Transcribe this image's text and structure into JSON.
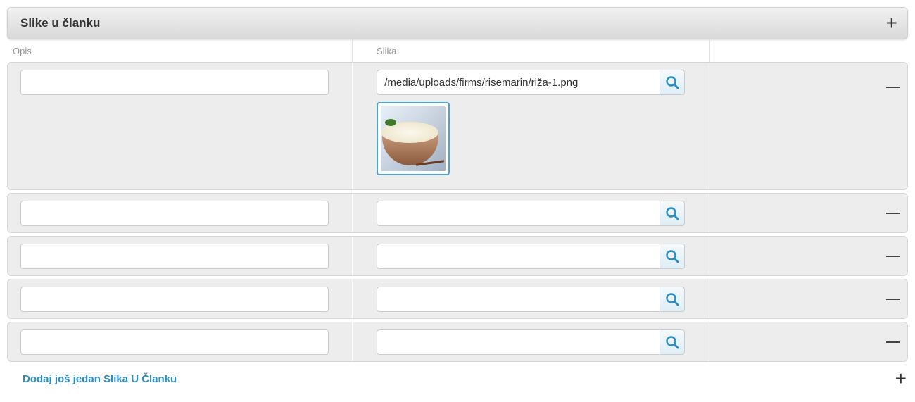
{
  "panel": {
    "title": "Slike u članku",
    "add_icon": "plus-icon"
  },
  "columns": {
    "description": "Opis",
    "image": "Slika",
    "actions": ""
  },
  "rows": [
    {
      "description": "",
      "image_path": "/media/uploads/firms/risemarin/riža-1.png",
      "has_thumbnail": true
    },
    {
      "description": "",
      "image_path": "",
      "has_thumbnail": false
    },
    {
      "description": "",
      "image_path": "",
      "has_thumbnail": false
    },
    {
      "description": "",
      "image_path": "",
      "has_thumbnail": false
    },
    {
      "description": "",
      "image_path": "",
      "has_thumbnail": false
    }
  ],
  "footer": {
    "add_label": "Dodaj još jedan Slika U Članku"
  },
  "colors": {
    "link": "#2a8ec4",
    "thumb_border": "#4fa3d1",
    "row_bg": "#ededed"
  }
}
